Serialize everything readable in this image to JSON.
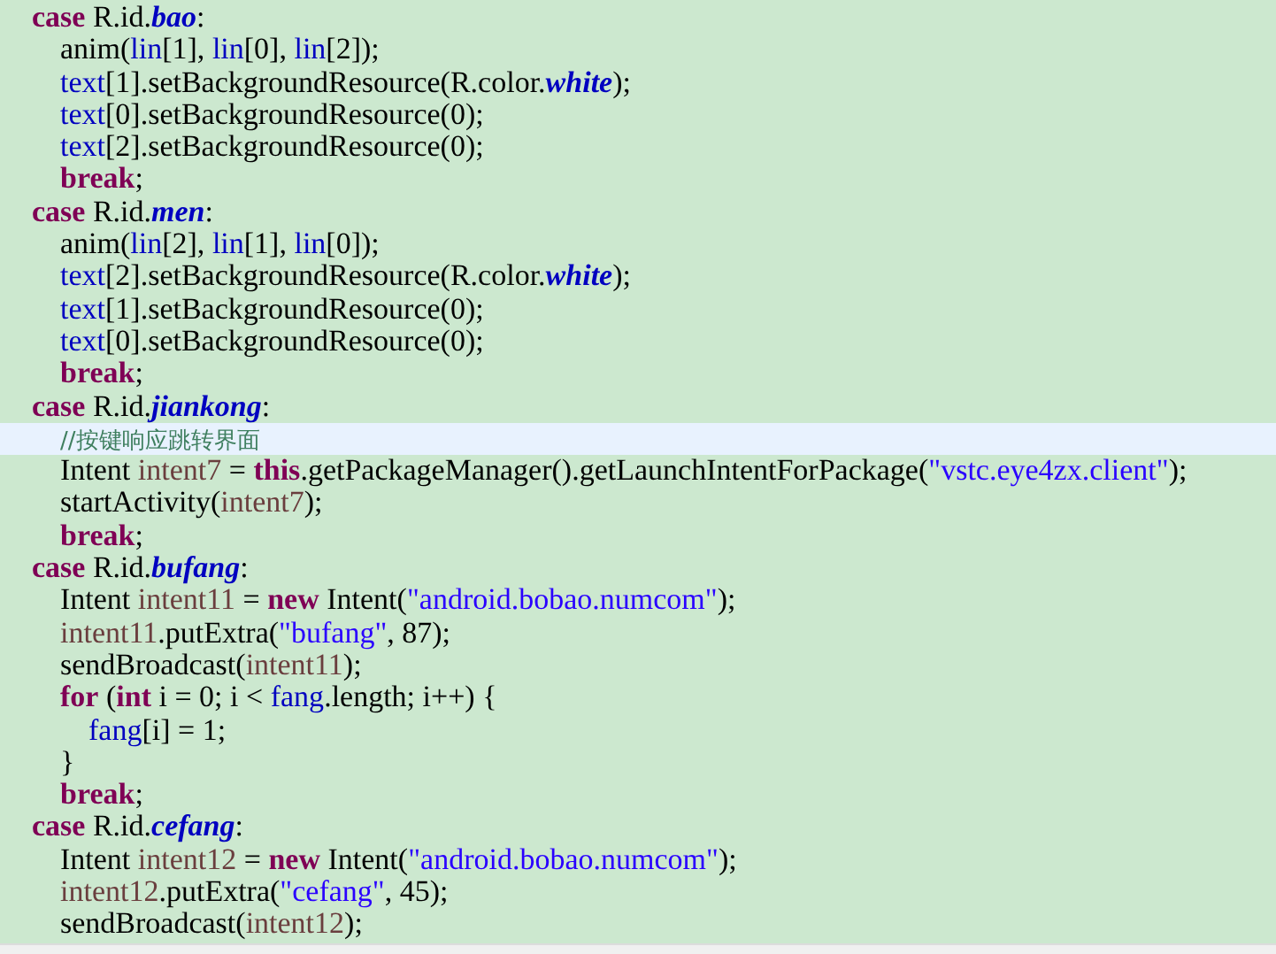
{
  "code_lines": [
    {
      "highlighted": false,
      "tokens": [
        {
          "kind": "keyword",
          "text": "\tcase"
        },
        {
          "kind": "plain",
          "text": " R.id."
        },
        {
          "kind": "constant",
          "text": "bao"
        },
        {
          "kind": "plain",
          "text": ":"
        }
      ]
    },
    {
      "highlighted": false,
      "tokens": [
        {
          "kind": "plain",
          "text": "\t\tanim("
        },
        {
          "kind": "field",
          "text": "lin"
        },
        {
          "kind": "plain",
          "text": "[1], "
        },
        {
          "kind": "field",
          "text": "lin"
        },
        {
          "kind": "plain",
          "text": "[0], "
        },
        {
          "kind": "field",
          "text": "lin"
        },
        {
          "kind": "plain",
          "text": "[2]);"
        }
      ]
    },
    {
      "highlighted": false,
      "tokens": [
        {
          "kind": "field",
          "text": "\t\ttext"
        },
        {
          "kind": "plain",
          "text": "[1].setBackgroundResource(R.color."
        },
        {
          "kind": "constant",
          "text": "white"
        },
        {
          "kind": "plain",
          "text": ");"
        }
      ]
    },
    {
      "highlighted": false,
      "tokens": [
        {
          "kind": "field",
          "text": "\t\ttext"
        },
        {
          "kind": "plain",
          "text": "[0].setBackgroundResource(0);"
        }
      ]
    },
    {
      "highlighted": false,
      "tokens": [
        {
          "kind": "field",
          "text": "\t\ttext"
        },
        {
          "kind": "plain",
          "text": "[2].setBackgroundResource(0);"
        }
      ]
    },
    {
      "highlighted": false,
      "tokens": [
        {
          "kind": "keyword",
          "text": "\t\tbreak"
        },
        {
          "kind": "plain",
          "text": ";"
        }
      ]
    },
    {
      "highlighted": false,
      "tokens": [
        {
          "kind": "keyword",
          "text": "\tcase"
        },
        {
          "kind": "plain",
          "text": " R.id."
        },
        {
          "kind": "constant",
          "text": "men"
        },
        {
          "kind": "plain",
          "text": ":"
        }
      ]
    },
    {
      "highlighted": false,
      "tokens": [
        {
          "kind": "plain",
          "text": "\t\tanim("
        },
        {
          "kind": "field",
          "text": "lin"
        },
        {
          "kind": "plain",
          "text": "[2], "
        },
        {
          "kind": "field",
          "text": "lin"
        },
        {
          "kind": "plain",
          "text": "[1], "
        },
        {
          "kind": "field",
          "text": "lin"
        },
        {
          "kind": "plain",
          "text": "[0]);"
        }
      ]
    },
    {
      "highlighted": false,
      "tokens": [
        {
          "kind": "field",
          "text": "\t\ttext"
        },
        {
          "kind": "plain",
          "text": "[2].setBackgroundResource(R.color."
        },
        {
          "kind": "constant",
          "text": "white"
        },
        {
          "kind": "plain",
          "text": ");"
        }
      ]
    },
    {
      "highlighted": false,
      "tokens": [
        {
          "kind": "field",
          "text": "\t\ttext"
        },
        {
          "kind": "plain",
          "text": "[1].setBackgroundResource(0);"
        }
      ]
    },
    {
      "highlighted": false,
      "tokens": [
        {
          "kind": "field",
          "text": "\t\ttext"
        },
        {
          "kind": "plain",
          "text": "[0].setBackgroundResource(0);"
        }
      ]
    },
    {
      "highlighted": false,
      "tokens": [
        {
          "kind": "keyword",
          "text": "\t\tbreak"
        },
        {
          "kind": "plain",
          "text": ";"
        }
      ]
    },
    {
      "highlighted": false,
      "tokens": [
        {
          "kind": "keyword",
          "text": "\tcase"
        },
        {
          "kind": "plain",
          "text": " R.id."
        },
        {
          "kind": "constant",
          "text": "jiankong"
        },
        {
          "kind": "plain",
          "text": ":"
        }
      ]
    },
    {
      "highlighted": true,
      "tokens": [
        {
          "kind": "comment",
          "text": "\t\t//按键响应跳转界面"
        }
      ]
    },
    {
      "highlighted": false,
      "tokens": [
        {
          "kind": "plain",
          "text": "\t\tIntent "
        },
        {
          "kind": "local",
          "text": "intent7"
        },
        {
          "kind": "plain",
          "text": " = "
        },
        {
          "kind": "keyword",
          "text": "this"
        },
        {
          "kind": "plain",
          "text": ".getPackageManager().getLaunchIntentForPackage("
        },
        {
          "kind": "string",
          "text": "\"vstc.eye4zx.client\""
        },
        {
          "kind": "plain",
          "text": ");"
        }
      ]
    },
    {
      "highlighted": false,
      "tokens": [
        {
          "kind": "plain",
          "text": "\t\tstartActivity("
        },
        {
          "kind": "local",
          "text": "intent7"
        },
        {
          "kind": "plain",
          "text": ");"
        }
      ]
    },
    {
      "highlighted": false,
      "tokens": [
        {
          "kind": "keyword",
          "text": "\t\tbreak"
        },
        {
          "kind": "plain",
          "text": ";"
        }
      ]
    },
    {
      "highlighted": false,
      "tokens": [
        {
          "kind": "keyword",
          "text": "\tcase"
        },
        {
          "kind": "plain",
          "text": " R.id."
        },
        {
          "kind": "constant",
          "text": "bufang"
        },
        {
          "kind": "plain",
          "text": ":"
        }
      ]
    },
    {
      "highlighted": false,
      "tokens": [
        {
          "kind": "plain",
          "text": "\t\tIntent "
        },
        {
          "kind": "local",
          "text": "intent11"
        },
        {
          "kind": "plain",
          "text": " = "
        },
        {
          "kind": "keyword",
          "text": "new"
        },
        {
          "kind": "plain",
          "text": " Intent("
        },
        {
          "kind": "string",
          "text": "\"android.bobao.numcom\""
        },
        {
          "kind": "plain",
          "text": ");"
        }
      ]
    },
    {
      "highlighted": false,
      "tokens": [
        {
          "kind": "local",
          "text": "\t\tintent11"
        },
        {
          "kind": "plain",
          "text": ".putExtra("
        },
        {
          "kind": "string",
          "text": "\"bufang\""
        },
        {
          "kind": "plain",
          "text": ", 87);"
        }
      ]
    },
    {
      "highlighted": false,
      "tokens": [
        {
          "kind": "plain",
          "text": "\t\tsendBroadcast("
        },
        {
          "kind": "local",
          "text": "intent11"
        },
        {
          "kind": "plain",
          "text": ");"
        }
      ]
    },
    {
      "highlighted": false,
      "tokens": [
        {
          "kind": "keyword",
          "text": "\t\tfor"
        },
        {
          "kind": "plain",
          "text": " ("
        },
        {
          "kind": "keyword",
          "text": "int"
        },
        {
          "kind": "plain",
          "text": " i = 0; i < "
        },
        {
          "kind": "field",
          "text": "fang"
        },
        {
          "kind": "plain",
          "text": ".length; i++) {"
        }
      ]
    },
    {
      "highlighted": false,
      "tokens": [
        {
          "kind": "field",
          "text": "\t\t\tfang"
        },
        {
          "kind": "plain",
          "text": "[i] = 1;"
        }
      ]
    },
    {
      "highlighted": false,
      "tokens": [
        {
          "kind": "plain",
          "text": "\t\t}"
        }
      ]
    },
    {
      "highlighted": false,
      "tokens": [
        {
          "kind": "keyword",
          "text": "\t\tbreak"
        },
        {
          "kind": "plain",
          "text": ";"
        }
      ]
    },
    {
      "highlighted": false,
      "tokens": [
        {
          "kind": "keyword",
          "text": "\tcase"
        },
        {
          "kind": "plain",
          "text": " R.id."
        },
        {
          "kind": "constant",
          "text": "cefang"
        },
        {
          "kind": "plain",
          "text": ":"
        }
      ]
    },
    {
      "highlighted": false,
      "tokens": [
        {
          "kind": "plain",
          "text": "\t\tIntent "
        },
        {
          "kind": "local",
          "text": "intent12"
        },
        {
          "kind": "plain",
          "text": " = "
        },
        {
          "kind": "keyword",
          "text": "new"
        },
        {
          "kind": "plain",
          "text": " Intent("
        },
        {
          "kind": "string",
          "text": "\"android.bobao.numcom\""
        },
        {
          "kind": "plain",
          "text": ");"
        }
      ]
    },
    {
      "highlighted": false,
      "tokens": [
        {
          "kind": "local",
          "text": "\t\tintent12"
        },
        {
          "kind": "plain",
          "text": ".putExtra("
        },
        {
          "kind": "string",
          "text": "\"cefang\""
        },
        {
          "kind": "plain",
          "text": ", 45);"
        }
      ]
    },
    {
      "highlighted": false,
      "tokens": [
        {
          "kind": "plain",
          "text": "\t\tsendBroadcast("
        },
        {
          "kind": "local",
          "text": "intent12"
        },
        {
          "kind": "plain",
          "text": ");"
        }
      ]
    }
  ]
}
